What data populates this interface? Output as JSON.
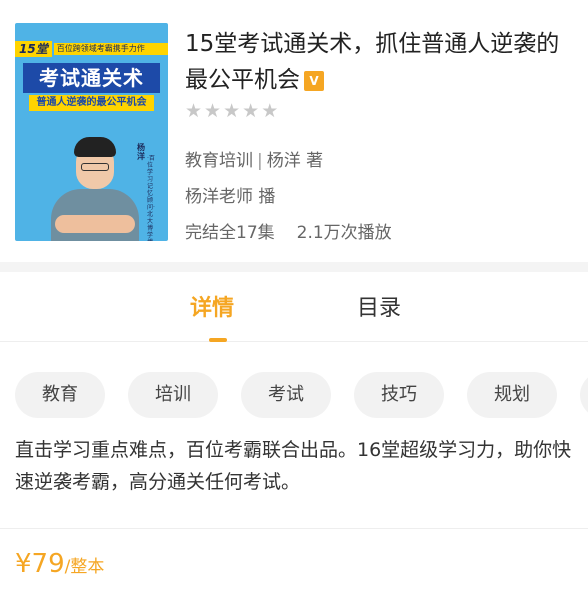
{
  "album": {
    "cover": {
      "num_badge": "15堂",
      "tagline": "百位跨领域考霸携手力作",
      "title": "考试通关术",
      "subtitle": "普通人逆袭的最公平机会",
      "author_name": "杨洋",
      "side_text": "·百位学习记忆顾问·北大博学博士·"
    },
    "title": "15堂考试通关术，抓住普通人逆袭的最公平机会",
    "vip_badge": "V",
    "rating_stars": 5,
    "category": "教育培训",
    "separator": "|",
    "author": "杨洋 著",
    "host": "杨洋老师 播",
    "episodes": "完结全17集",
    "plays": "2.1万次播放"
  },
  "tabs": [
    {
      "label": "详情",
      "active": true
    },
    {
      "label": "目录",
      "active": false
    }
  ],
  "tags": [
    "教育",
    "培训",
    "考试",
    "技巧",
    "规划"
  ],
  "description": "直击学习重点难点，百位考霸联合出品。16堂超级学习力，助你快速逆袭考霸，高分通关任何考试。",
  "price": {
    "value": "¥79",
    "unit": "/整本"
  },
  "colors": {
    "accent": "#f5a623",
    "star_inactive": "#c8c8c8",
    "tag_bg": "#f2f2f2"
  }
}
